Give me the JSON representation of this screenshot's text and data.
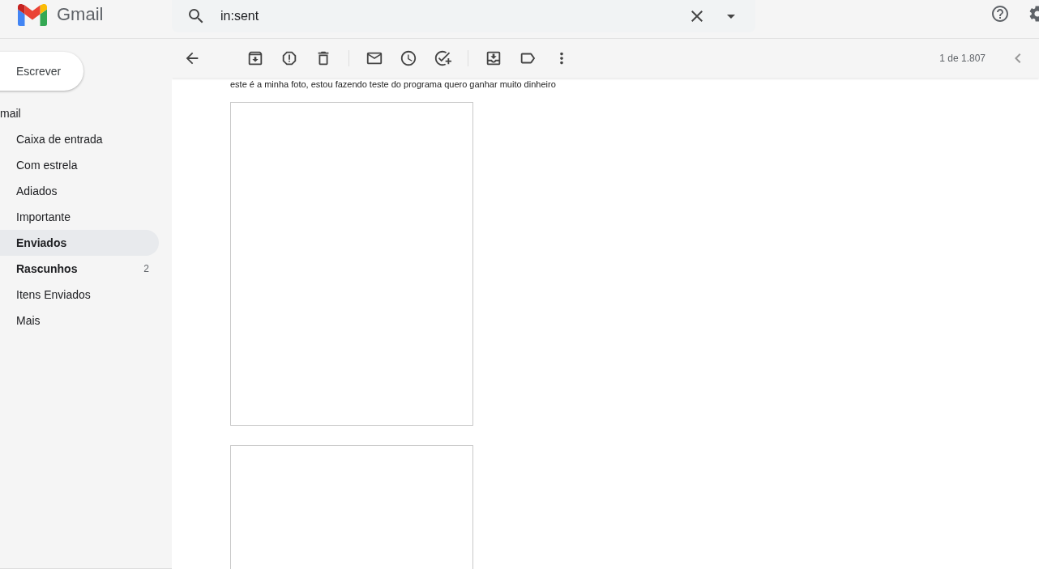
{
  "header": {
    "app_name": "Gmail",
    "search": {
      "value": "in:sent"
    }
  },
  "sidebar": {
    "compose": "Escrever",
    "section": "mail",
    "items": [
      {
        "label": "Caixa de entrada",
        "selected": false,
        "unread": false
      },
      {
        "label": "Com estrela",
        "selected": false,
        "unread": false
      },
      {
        "label": "Adiados",
        "selected": false,
        "unread": false
      },
      {
        "label": "Importante",
        "selected": false,
        "unread": false
      },
      {
        "label": "Enviados",
        "selected": true,
        "unread": false
      },
      {
        "label": "Rascunhos",
        "selected": false,
        "unread": true,
        "count": "2"
      },
      {
        "label": "Itens Enviados",
        "selected": false,
        "unread": false
      },
      {
        "label": "Mais",
        "selected": false,
        "unread": false
      }
    ]
  },
  "toolbar": {
    "pagination": "1 de 1.807"
  },
  "message": {
    "body": "este é a minha foto, estou fazendo teste do programa quero ganhar muito dinheiro",
    "attachments": [
      {
        "kind": "image"
      },
      {
        "kind": "image"
      }
    ]
  }
}
